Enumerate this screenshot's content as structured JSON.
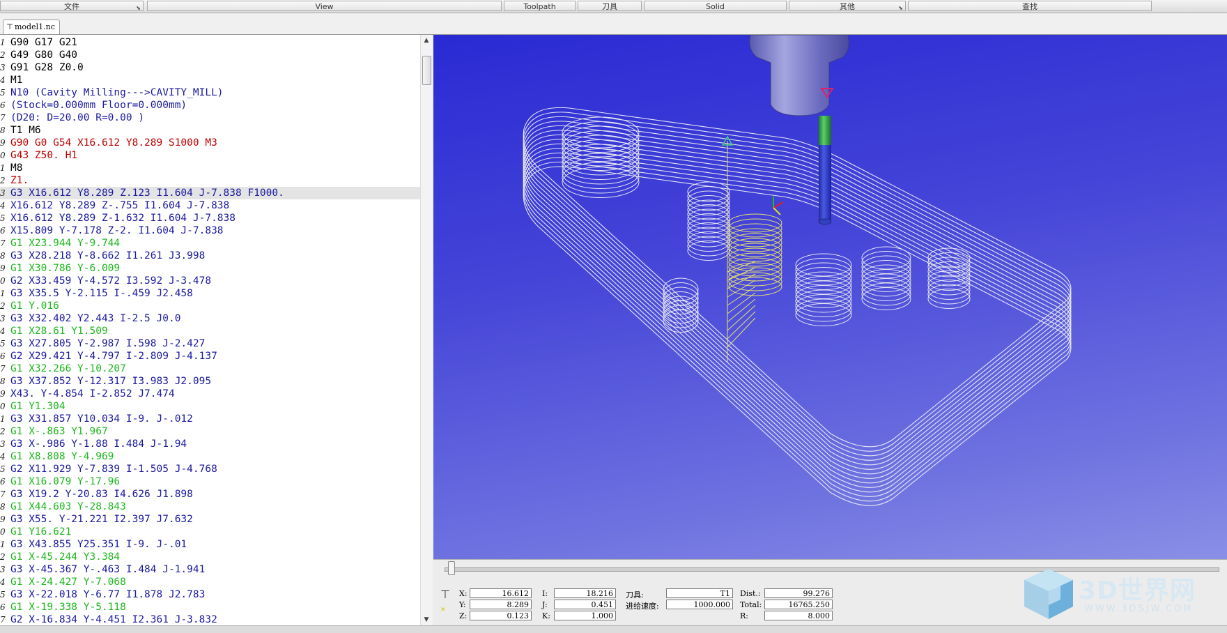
{
  "menubar": {
    "file": "文件",
    "view": "View",
    "toolpath": "Toolpath",
    "tool": "刀具",
    "solid": "Solid",
    "other": "其他",
    "search": "查找"
  },
  "tab": {
    "filename": "model1.nc"
  },
  "code": {
    "highlighted_line": 14,
    "lines": [
      {
        "n": "1",
        "t": "G90 G17 G21",
        "c": "black"
      },
      {
        "n": "2",
        "t": "G49 G80 G40",
        "c": "black"
      },
      {
        "n": "3",
        "t": "G91 G28 Z0.0",
        "c": "black"
      },
      {
        "n": "4",
        "t": "M1",
        "c": "black"
      },
      {
        "n": "5",
        "t": "N10 (Cavity Milling--->CAVITY_MILL)",
        "c": "navy"
      },
      {
        "n": "6",
        "t": "(Stock=0.000mm Floor=0.000mm)",
        "c": "navy"
      },
      {
        "n": "7",
        "t": "(D20: D=20.00 R=0.00 )",
        "c": "navy"
      },
      {
        "n": "8",
        "t": "T1 M6",
        "c": "black"
      },
      {
        "n": "9",
        "t": "G90 G0 G54 X16.612 Y8.289 S1000 M3",
        "c": "red"
      },
      {
        "n": "0",
        "t": "G43 Z50. H1",
        "c": "red"
      },
      {
        "n": "1",
        "t": "M8",
        "c": "black"
      },
      {
        "n": "2",
        "t": "Z1.",
        "c": "red"
      },
      {
        "n": "3",
        "t": "G3 X16.612 Y8.289 Z.123 I1.604 J-7.838 F1000.",
        "c": "navy"
      },
      {
        "n": "4",
        "t": "X16.612 Y8.289 Z-.755 I1.604 J-7.838",
        "c": "navy"
      },
      {
        "n": "5",
        "t": "X16.612 Y8.289 Z-1.632 I1.604 J-7.838",
        "c": "navy"
      },
      {
        "n": "6",
        "t": "X15.809 Y-7.178 Z-2. I1.604 J-7.838",
        "c": "navy"
      },
      {
        "n": "7",
        "t": "G1 X23.944 Y-9.744",
        "c": "green"
      },
      {
        "n": "8",
        "t": "G3 X28.218 Y-8.662 I1.261 J3.998",
        "c": "navy"
      },
      {
        "n": "9",
        "t": "G1 X30.786 Y-6.009",
        "c": "green"
      },
      {
        "n": "0",
        "t": "G2 X33.459 Y-4.572 I3.592 J-3.478",
        "c": "navy"
      },
      {
        "n": "1",
        "t": "G3 X35.5 Y-2.115 I-.459 J2.458",
        "c": "navy"
      },
      {
        "n": "2",
        "t": "G1 Y.016",
        "c": "green"
      },
      {
        "n": "3",
        "t": "G3 X32.402 Y2.443 I-2.5 J0.0",
        "c": "navy"
      },
      {
        "n": "4",
        "t": "G1 X28.61 Y1.509",
        "c": "green"
      },
      {
        "n": "5",
        "t": "G3 X27.805 Y-2.987 I.598 J-2.427",
        "c": "navy"
      },
      {
        "n": "6",
        "t": "G2 X29.421 Y-4.797 I-2.809 J-4.137",
        "c": "navy"
      },
      {
        "n": "7",
        "t": "G1 X32.266 Y-10.207",
        "c": "green"
      },
      {
        "n": "8",
        "t": "G3 X37.852 Y-12.317 I3.983 J2.095",
        "c": "navy"
      },
      {
        "n": "9",
        "t": "X43. Y-4.854 I-2.852 J7.474",
        "c": "navy"
      },
      {
        "n": "0",
        "t": "G1 Y1.304",
        "c": "green"
      },
      {
        "n": "1",
        "t": "G3 X31.857 Y10.034 I-9. J-.012",
        "c": "navy"
      },
      {
        "n": "2",
        "t": "G1 X-.863 Y1.967",
        "c": "green"
      },
      {
        "n": "3",
        "t": "G3 X-.986 Y-1.88 I.484 J-1.94",
        "c": "navy"
      },
      {
        "n": "4",
        "t": "G1 X8.808 Y-4.969",
        "c": "green"
      },
      {
        "n": "5",
        "t": "G2 X11.929 Y-7.839 I-1.505 J-4.768",
        "c": "navy"
      },
      {
        "n": "6",
        "t": "G1 X16.079 Y-17.96",
        "c": "green"
      },
      {
        "n": "7",
        "t": "G3 X19.2 Y-20.83 I4.626 J1.898",
        "c": "navy"
      },
      {
        "n": "8",
        "t": "G1 X44.603 Y-28.843",
        "c": "green"
      },
      {
        "n": "9",
        "t": "G3 X55. Y-21.221 I2.397 J7.632",
        "c": "navy"
      },
      {
        "n": "0",
        "t": "G1 Y16.621",
        "c": "green"
      },
      {
        "n": "1",
        "t": "G3 X43.855 Y25.351 I-9. J-.01",
        "c": "navy"
      },
      {
        "n": "2",
        "t": "G1 X-45.244 Y3.384",
        "c": "green"
      },
      {
        "n": "3",
        "t": "G3 X-45.367 Y-.463 I.484 J-1.941",
        "c": "navy"
      },
      {
        "n": "4",
        "t": "G1 X-24.427 Y-7.068",
        "c": "green"
      },
      {
        "n": "5",
        "t": "G3 X-22.018 Y-6.77 I1.878 J2.783",
        "c": "navy"
      },
      {
        "n": "6",
        "t": "G1 X-19.338 Y-5.118",
        "c": "green"
      },
      {
        "n": "7",
        "t": "G2 X-16.834 Y-4.451 I2.361 J-3.832",
        "c": "navy"
      }
    ]
  },
  "status": {
    "x_label": "X:",
    "x": "16.612",
    "y_label": "Y:",
    "y": "8.289",
    "z_label": "Z:",
    "z": "0.123",
    "i_label": "I:",
    "i": "18.216",
    "j_label": "J:",
    "j": "0.451",
    "k_label": "K:",
    "k": "1.000",
    "tool_label": "刀具:",
    "tool": "T1",
    "feed_label": "进给速度:",
    "feed": "1000.000",
    "dist_label": "Dist.:",
    "dist": "99.276",
    "total_label": "Total:",
    "total": "16765.250",
    "r_label": "R:",
    "r": "8.000",
    "progress": 0.003
  },
  "watermark": {
    "brand": "3D世界网",
    "url": "WWW.3DSJW.COM"
  },
  "colors": {
    "navy_code": "#1a1aa0",
    "red_code": "#c00000",
    "green_code": "#1db81d",
    "viewport_bg": "#3b3bd6",
    "toolpath": "#e6e6f2",
    "highlight_path": "#e8e070"
  }
}
